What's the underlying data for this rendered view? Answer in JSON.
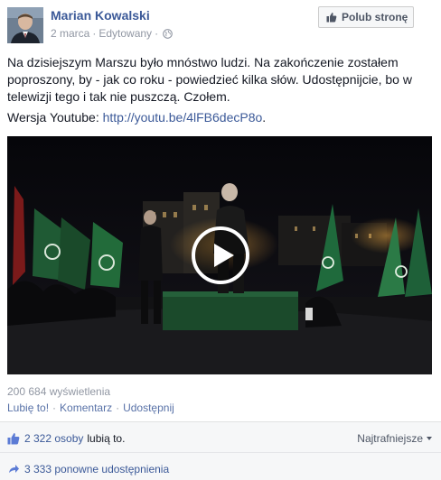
{
  "post": {
    "author": "Marian Kowalski",
    "date": "2 marca",
    "separator": "·",
    "edited": "Edytowany",
    "like_page_label": "Polub stronę",
    "text": "Na dzisiejszym Marszu było mnóstwo ludzi. Na zakończenie zostałem poproszony, by - jak co roku - powiedzieć kilka słów. Udostępnijcie, bo w telewizji tego i tak nie puszczą. Czołem.",
    "youtube_prefix": "Wersja Youtube: ",
    "youtube_link": "http://youtu.be/4lFB6decP8o",
    "youtube_suffix": "."
  },
  "video": {
    "views": "200 684 wyświetlenia",
    "icons": [
      "play-icon"
    ]
  },
  "actions": {
    "like": "Lubię to!",
    "comment": "Komentarz",
    "share": "Udostępnij",
    "dot": "·"
  },
  "ufi": {
    "likes_count": "2 322 osoby",
    "likes_suffix": "lubią to.",
    "sort_label": "Najtrafniejsze",
    "shares": "3 333 ponowne udostępnienia"
  },
  "colors": {
    "link": "#3b5998",
    "meta": "#9197a3",
    "ufi_bg": "#f6f7f8"
  }
}
